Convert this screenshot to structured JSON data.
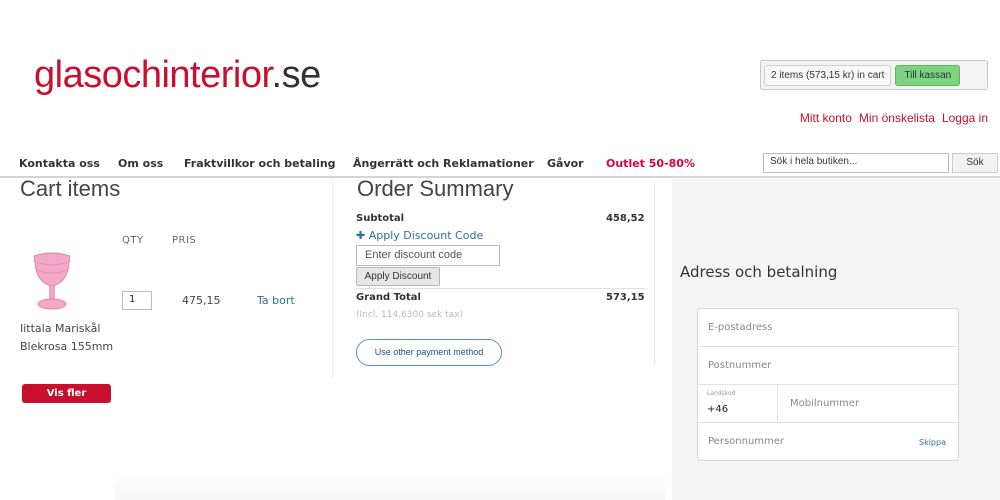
{
  "header": {
    "logo_main": "glasochinterior",
    "logo_tld": ".se",
    "cart_summary": "2 items (573,15 kr) in cart",
    "checkout_label": "Till kassan",
    "account_links": [
      "Mitt konto",
      "Min önskelista",
      "Logga in"
    ]
  },
  "nav": {
    "items": [
      "Kontakta oss",
      "Om oss",
      "Fraktvillkor och betaling",
      "Ångerrätt och Reklamationer",
      "Gåvor",
      "Outlet 50-80%"
    ],
    "search_placeholder": "Sök i hela butiken...",
    "search_button": "Sök"
  },
  "cart": {
    "title": "Cart items",
    "col_qty": "QTY",
    "col_price": "PRIS",
    "item": {
      "name": "Iittala Mariskål Blekrosa 155mm",
      "qty": "1",
      "price": "475,15",
      "remove": "Ta bort"
    },
    "more_button": "Vis fler"
  },
  "summary": {
    "title": "Order Summary",
    "subtotal_label": "Subtotal",
    "subtotal_value": "458,52",
    "discount_link": "Apply Discount Code",
    "discount_placeholder": "Enter discount code",
    "discount_button": "Apply Discount",
    "grand_total_label": "Grand Total",
    "grand_total_value": "573,15",
    "tax_note": "(Incl. 114.6300 sek tax)",
    "other_payment": "Use other payment method"
  },
  "address": {
    "title": "Adress och betalning",
    "email_ph": "E-postadress",
    "postnummer_ph": "Postnummer",
    "landskod_label": "Landskod",
    "landskod_value": "+46",
    "mobil_ph": "Mobilnummer",
    "personnummer_ph": "Personnummer",
    "skip": "Skippa"
  },
  "colors": {
    "brand_red": "#c8102e",
    "link_blue": "#2b6ea8",
    "checkout_green": "#7ed47e"
  }
}
